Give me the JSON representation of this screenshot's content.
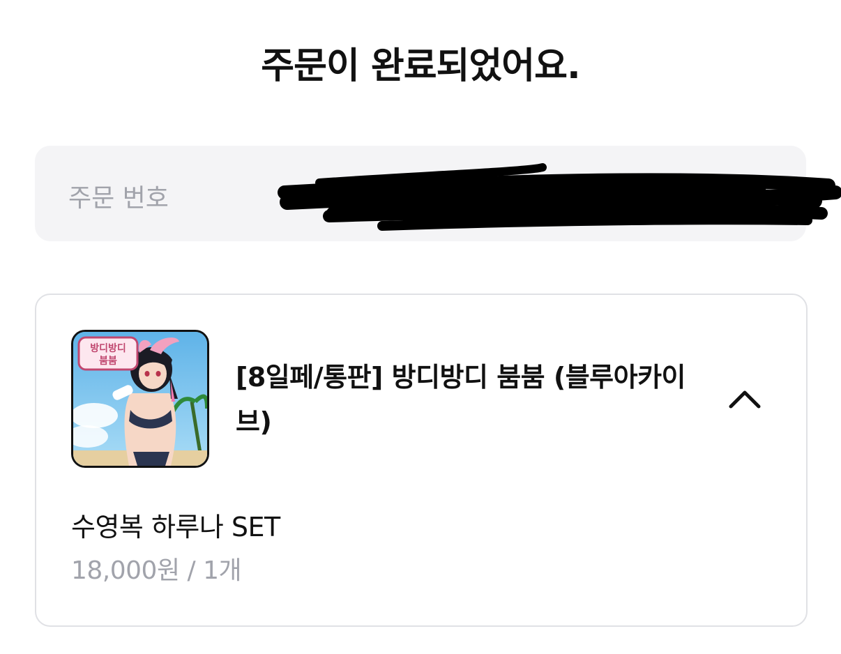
{
  "page": {
    "title": "주문이 완료되었어요."
  },
  "order": {
    "number_label": "주문 번호",
    "number_value": ""
  },
  "product": {
    "title": "[8일페/통판] 방디방디 붐붐 (블루아카이브)",
    "thumbnail_logo_text": "방디방디 붐붐",
    "collapse_icon": "chevron-up-icon",
    "option_name": "수영복 하루나 SET",
    "option_price": "18,000원 / 1개"
  },
  "colors": {
    "background": "#ffffff",
    "title_text": "#111111",
    "muted_text": "#a1a3ab",
    "order_box_bg": "#f4f4f6",
    "card_border": "#e0e1e5",
    "redaction": "#000000"
  }
}
